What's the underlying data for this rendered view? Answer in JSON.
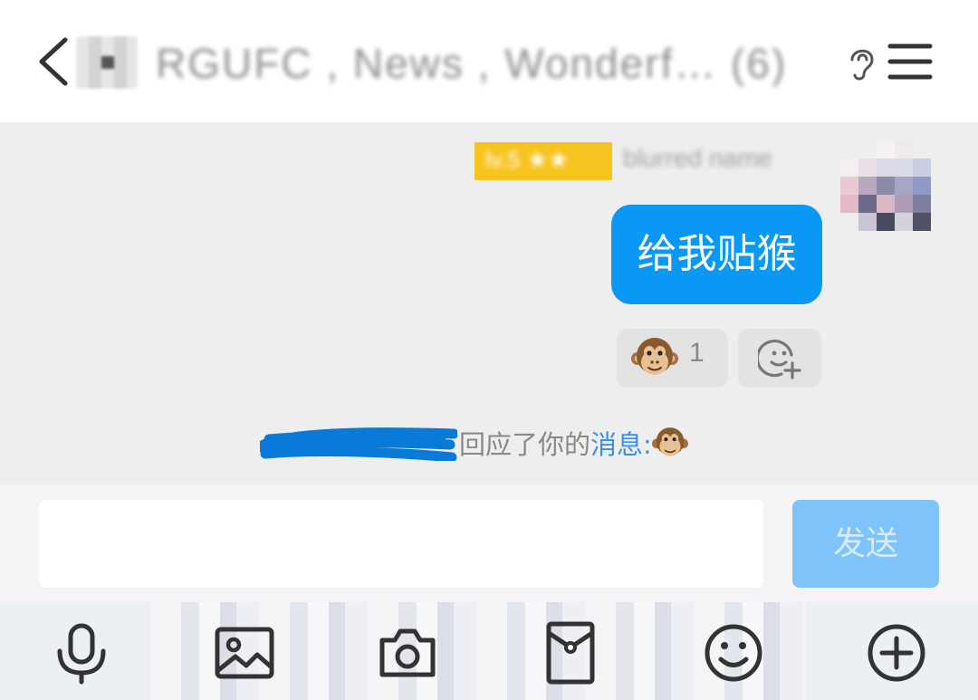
{
  "header": {
    "title": "RGUFC , News , Wonderf… (6)",
    "back_icon": "chevron-left-icon",
    "ear_icon": "ear-icon",
    "menu_icon": "hamburger-menu-icon"
  },
  "message": {
    "sender_badge": "lv.5 ★★",
    "sender_name": "blurred name",
    "text": "给我贴猴",
    "bubble_color": "#0a98f5"
  },
  "reactions": [
    {
      "emoji": "🐵",
      "icon": "monkey-face-icon",
      "count": "1"
    },
    {
      "icon": "add-reaction-icon"
    }
  ],
  "notice": {
    "text": "回应了你的",
    "link": "消息:",
    "emoji": "🐵"
  },
  "composer": {
    "value": "",
    "placeholder": "",
    "send_label": "发送",
    "send_color": "#7ec4fa"
  },
  "toolbar": {
    "items": [
      {
        "icon": "microphone-icon"
      },
      {
        "icon": "image-icon"
      },
      {
        "icon": "camera-icon"
      },
      {
        "icon": "red-packet-icon"
      },
      {
        "icon": "emoji-icon"
      },
      {
        "icon": "plus-circle-icon"
      }
    ]
  }
}
